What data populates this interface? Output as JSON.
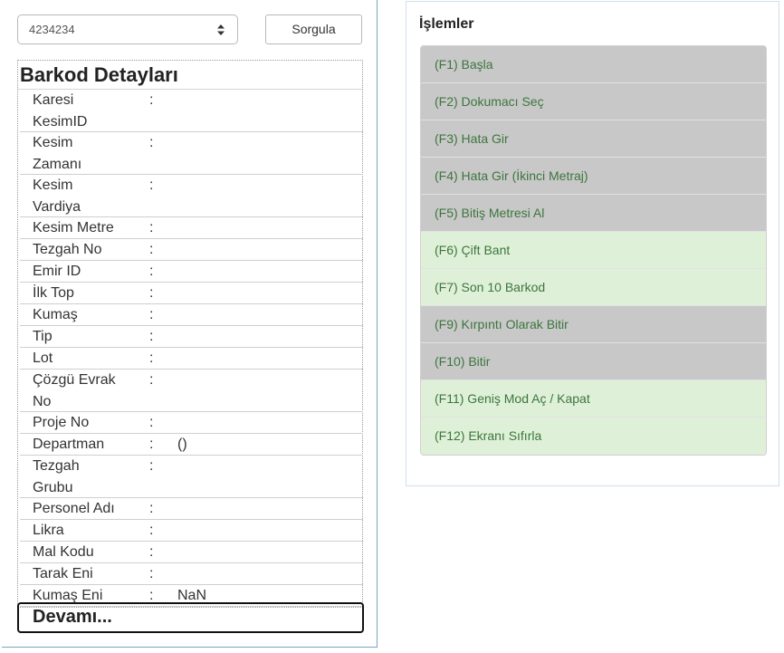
{
  "search": {
    "barcode_value": "4234234",
    "query_button": "Sorgula"
  },
  "details": {
    "title": "Barkod Detayları",
    "rows": [
      {
        "label": "Karesi KesimID",
        "colon": ":",
        "value": ""
      },
      {
        "label": "Kesim Zamanı",
        "colon": ":",
        "value": ""
      },
      {
        "label": "Kesim Vardiya",
        "colon": ":",
        "value": ""
      },
      {
        "label": "Kesim Metre",
        "colon": ":",
        "value": ""
      },
      {
        "label": "Tezgah No",
        "colon": ":",
        "value": ""
      },
      {
        "label": "Emir ID",
        "colon": ":",
        "value": ""
      },
      {
        "label": "İlk Top",
        "colon": ":",
        "value": ""
      },
      {
        "label": "Kumaş",
        "colon": ":",
        "value": ""
      },
      {
        "label": "Tip",
        "colon": ":",
        "value": ""
      },
      {
        "label": "Lot",
        "colon": ":",
        "value": ""
      },
      {
        "label": "Çözgü Evrak No",
        "colon": ":",
        "value": ""
      },
      {
        "label": "Proje No",
        "colon": ":",
        "value": ""
      },
      {
        "label": "Departman",
        "colon": ":",
        "value": "()"
      },
      {
        "label": "Tezgah Grubu",
        "colon": ":",
        "value": ""
      },
      {
        "label": "Personel Adı",
        "colon": ":",
        "value": ""
      },
      {
        "label": "Likra",
        "colon": ":",
        "value": ""
      },
      {
        "label": "Mal Kodu",
        "colon": ":",
        "value": ""
      },
      {
        "label": "Tarak Eni",
        "colon": ":",
        "value": ""
      },
      {
        "label": "Kumaş Eni",
        "colon": ":",
        "value": "NaN"
      }
    ],
    "more_button": "Devamı..."
  },
  "operations": {
    "title": "İşlemler",
    "items": [
      {
        "label": "(F1) Başla",
        "state": "disabled"
      },
      {
        "label": "(F2) Dokumacı Seç",
        "state": "disabled"
      },
      {
        "label": "(F3) Hata Gir",
        "state": "disabled"
      },
      {
        "label": "(F4) Hata Gir (İkinci Metraj)",
        "state": "disabled"
      },
      {
        "label": "(F5) Bitiş Metresi Al",
        "state": "disabled"
      },
      {
        "label": "(F6) Çift Bant",
        "state": "enabled"
      },
      {
        "label": "(F7) Son 10 Barkod",
        "state": "enabled"
      },
      {
        "label": "(F9) Kırpıntı Olarak Bitir",
        "state": "disabled"
      },
      {
        "label": "(F10) Bitir",
        "state": "disabled"
      },
      {
        "label": "(F11) Geniş Mod Aç / Kapat",
        "state": "enabled"
      },
      {
        "label": "(F12) Ekranı Sıfırla",
        "state": "enabled"
      }
    ]
  },
  "colors": {
    "disabled_bg": "#c8c8c8",
    "enabled_bg": "#dff0d8",
    "op_text": "#3c763d",
    "panel_border": "#7aa4c4"
  }
}
